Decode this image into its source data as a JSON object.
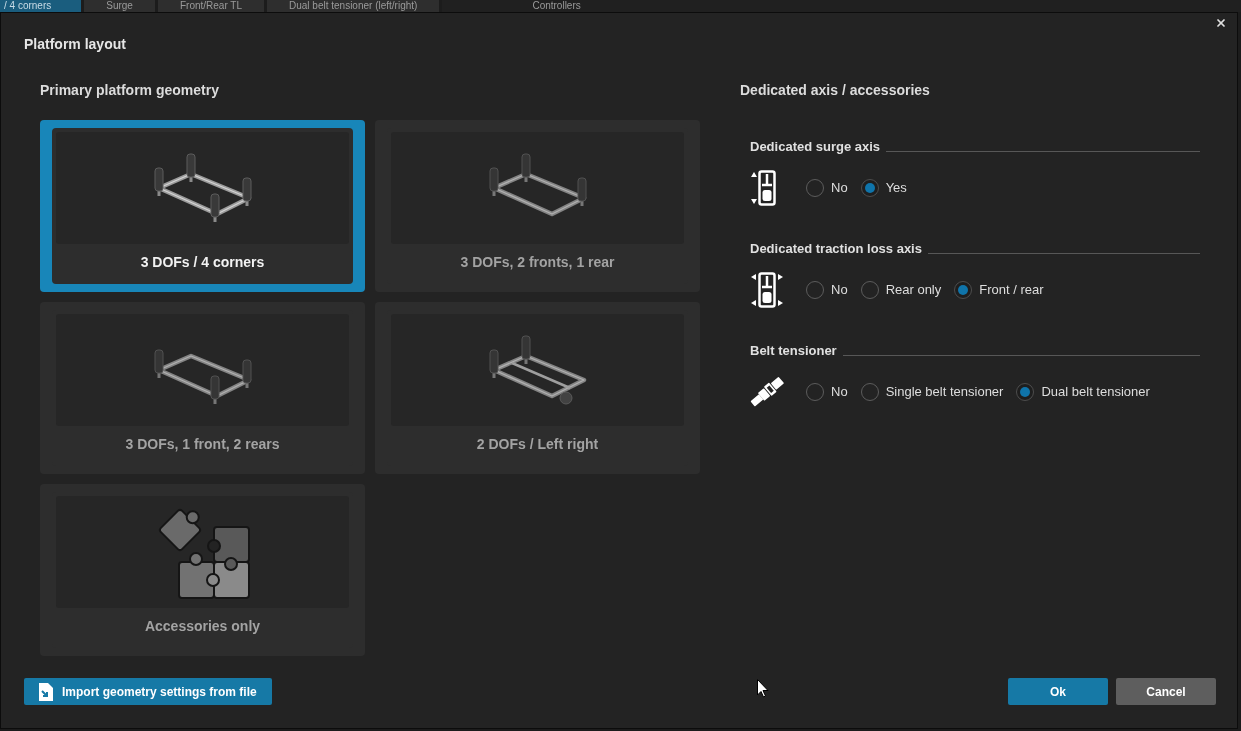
{
  "background_window": {
    "tabs": [
      {
        "label": "/ 4 corners",
        "selected": true
      },
      {
        "label": "Surge",
        "selected": false
      },
      {
        "label": "Front/Rear TL",
        "selected": false
      },
      {
        "label": "Dual belt tensioner (left/right)",
        "selected": false
      }
    ],
    "header": "Controllers"
  },
  "dialog": {
    "title": "Platform layout"
  },
  "geometry": {
    "heading": "Primary platform geometry",
    "options": [
      {
        "kind": "four_corners",
        "label": "3 DOFs / 4 corners",
        "selected": true
      },
      {
        "kind": "two_fronts_one_rear",
        "label": "3 DOFs, 2 fronts, 1 rear",
        "selected": false
      },
      {
        "kind": "one_front_two_rears",
        "label": "3 DOFs, 1 front, 2 rears",
        "selected": false
      },
      {
        "kind": "left_right",
        "label": "2 DOFs / Left right",
        "selected": false
      },
      {
        "kind": "accessories",
        "label": "Accessories only",
        "selected": false
      }
    ]
  },
  "accessories": {
    "heading": "Dedicated axis / accessories",
    "groups": [
      {
        "kind": "surge",
        "title": "Dedicated surge axis",
        "options": [
          {
            "label": "No",
            "selected": false
          },
          {
            "label": "Yes",
            "selected": true
          }
        ]
      },
      {
        "kind": "traction_loss",
        "title": "Dedicated traction loss axis",
        "options": [
          {
            "label": "No",
            "selected": false
          },
          {
            "label": "Rear only",
            "selected": false
          },
          {
            "label": "Front / rear",
            "selected": true
          }
        ]
      },
      {
        "kind": "belt",
        "title": "Belt tensioner",
        "options": [
          {
            "label": "No",
            "selected": false
          },
          {
            "label": "Single belt tensioner",
            "selected": false
          },
          {
            "label": "Dual belt tensioner",
            "selected": true
          }
        ]
      }
    ]
  },
  "footer": {
    "import_button": "Import geometry settings from file",
    "ok_button": "Ok",
    "cancel_button": "Cancel"
  }
}
